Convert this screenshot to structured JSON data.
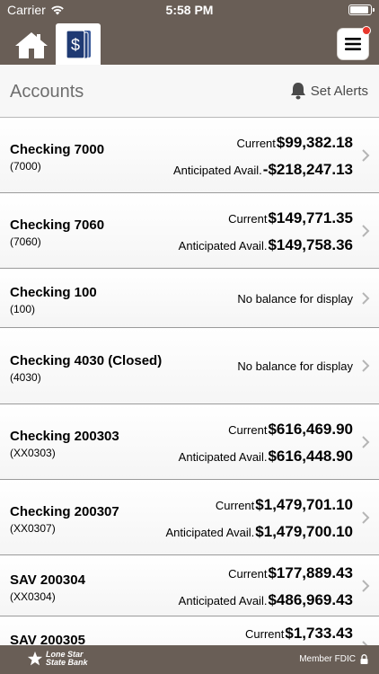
{
  "status_bar": {
    "carrier": "Carrier",
    "time": "5:58 PM"
  },
  "header": {
    "title": "Accounts",
    "set_alerts_label": "Set Alerts"
  },
  "labels": {
    "current": "Current",
    "anticipated": "Anticipated Avail.",
    "no_balance": "No balance for display"
  },
  "accounts": [
    {
      "name": "Checking 7000",
      "number": "(7000)",
      "current": "$99,382.18",
      "anticipated": "-$218,247.13"
    },
    {
      "name": "Checking 7060",
      "number": "(7060)",
      "current": "$149,771.35",
      "anticipated": "$149,758.36"
    },
    {
      "name": "Checking 100",
      "number": "(100)"
    },
    {
      "name": "Checking 4030 (Closed)",
      "number": "(4030)"
    },
    {
      "name": "Checking 200303",
      "number": "(XX0303)",
      "current": "$616,469.90",
      "anticipated": "$616,448.90"
    },
    {
      "name": "Checking 200307",
      "number": "(XX0307)",
      "current": "$1,479,701.10",
      "anticipated": "$1,479,700.10"
    },
    {
      "name": "SAV 200304",
      "number": "(XX0304)",
      "current": "$177,889.43",
      "anticipated": "$486,969.43"
    },
    {
      "name": "SAV 200305",
      "current": "$1,733.43"
    }
  ],
  "footer": {
    "bank_name_line1": "Lone Star",
    "bank_name_line2": "State Bank",
    "fdic": "Member FDIC"
  },
  "colors": {
    "brand_brown": "#695e56",
    "tab_blue": "#1f3a73",
    "notification_red": "#e8372c"
  }
}
